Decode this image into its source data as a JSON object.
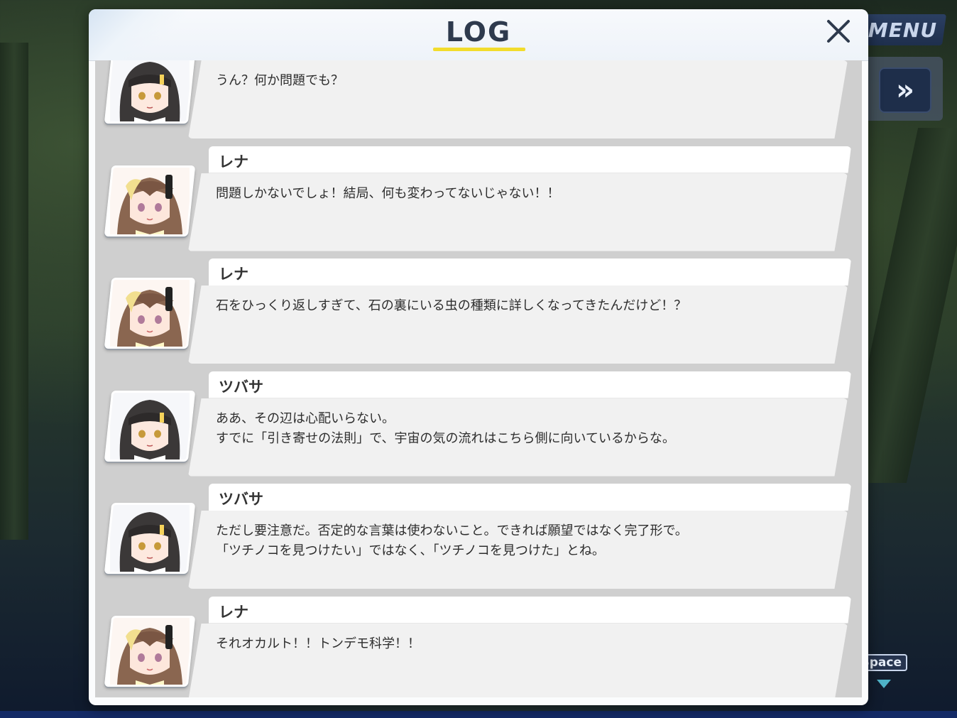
{
  "hud": {
    "menu_label": "MENU",
    "fast_forward_glyph": "»",
    "space_label": "Space"
  },
  "log": {
    "title": "LOG",
    "close_icon": "close-icon",
    "entries": [
      {
        "speaker": "",
        "avatar": "tsubasa-portrait",
        "lines": [
          "うん？何か問題でも？"
        ]
      },
      {
        "speaker": "レナ",
        "avatar": "rena-portrait",
        "lines": [
          "問題しかないでしょ！結局、何も変わってないじゃない！！"
        ]
      },
      {
        "speaker": "レナ",
        "avatar": "rena-portrait",
        "lines": [
          "石をひっくり返しすぎて、石の裏にいる虫の種類に詳しくなってきたんだけど！？"
        ]
      },
      {
        "speaker": "ツバサ",
        "avatar": "tsubasa-portrait",
        "lines": [
          "ああ、その辺は心配いらない。",
          "すでに「引き寄せの法則」で、宇宙の気の流れはこちら側に向いているからな。"
        ]
      },
      {
        "speaker": "ツバサ",
        "avatar": "tsubasa-portrait",
        "lines": [
          "ただし要注意だ。否定的な言葉は使わないこと。できれば願望ではなく完了形で。",
          "「ツチノコを見つけたい」ではなく、「ツチノコを見つけた」とね。"
        ]
      },
      {
        "speaker": "レナ",
        "avatar": "rena-portrait",
        "lines": [
          "それオカルト！！トンデモ科学！！"
        ]
      }
    ]
  },
  "colors": {
    "title_underline": "#f2dc2d",
    "panel_bg": "#fbfcfd",
    "list_bg": "#cfcfcf",
    "hud_button": "#1e2e4a"
  }
}
